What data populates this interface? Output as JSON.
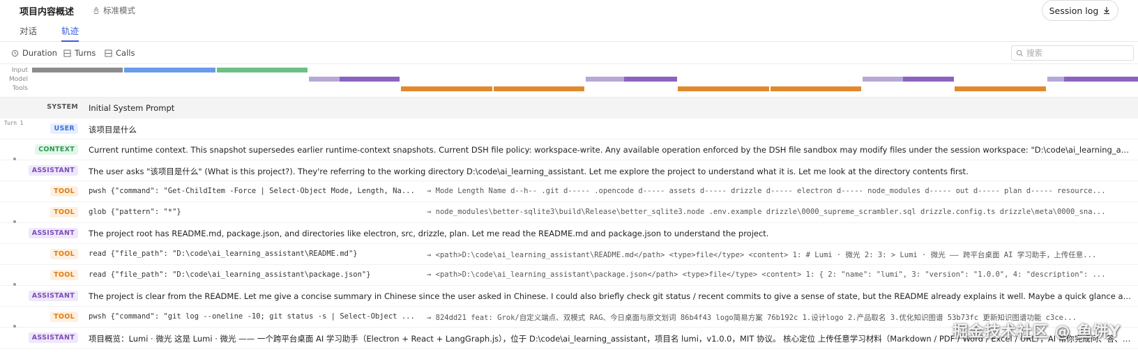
{
  "header": {
    "title": "项目内容概述",
    "mode_label": "标准模式",
    "tabs": [
      {
        "label": "对话"
      },
      {
        "label": "轨迹"
      }
    ],
    "session_log_label": "Session log"
  },
  "toolbar": {
    "duration_label": "Duration",
    "turns_label": "Turns",
    "calls_label": "Calls",
    "search_placeholder": "搜索"
  },
  "timeline": {
    "lanes": [
      "Input",
      "Model",
      "Tools"
    ],
    "colors": {
      "input_system": "#8c8c8c",
      "input_user": "#6b9ae8",
      "input_context": "#6dbf86",
      "model_light": "#b7a8d6",
      "model_dark": "#8a63c0",
      "tools": "#e08a2e"
    }
  },
  "rows": [
    {
      "type": "SYSTEM",
      "text": "Initial System Prompt"
    },
    {
      "type": "USER",
      "turn": "Turn 1",
      "text": "该项目是什么"
    },
    {
      "type": "CONTEXT",
      "text": "Current runtime context. This snapshot supersedes earlier runtime-context snapshots. Current DSH file policy: workspace-write. Any available operation enforced by the DSH file sandbox may modify files under the session workspace: \"D:\\code\\ai_learning_assistant\". Some platform t..."
    },
    {
      "type": "ASSISTANT",
      "text": "The user asks \"该项目是什么\" (What is this project?). They're referring to the working directory D:\\code\\ai_learning_assistant. Let me explore the project to understand what it is. Let me look at the directory contents first."
    },
    {
      "type": "TOOL",
      "cmd": "pwsh {\"command\": \"Get-ChildItem -Force | Select-Object Mode, Length, Na...",
      "out": "→ Mode Length Name d--h-- .git d----- .opencode d----- assets d----- drizzle d----- electron d----- node_modules d----- out d----- plan d----- resource..."
    },
    {
      "type": "TOOL",
      "cmd": "glob {\"pattern\": \"*\"}",
      "out": "→ node_modules\\better-sqlite3\\build\\Release\\better_sqlite3.node .env.example drizzle\\0000_supreme_scrambler.sql drizzle.config.ts drizzle\\meta\\0000_sna..."
    },
    {
      "type": "ASSISTANT",
      "text": "The project root has README.md, package.json, and directories like electron, src, drizzle, plan. Let me read the README.md and package.json to understand the project."
    },
    {
      "type": "TOOL",
      "cmd": "read {\"file_path\": \"D:\\code\\ai_learning_assistant\\README.md\"}",
      "out": "→ <path>D:\\code\\ai_learning_assistant\\README.md</path> <type>file</type> <content> 1: # Lumi · 微光 2: 3: > Lumi · 微光 —— 跨平台桌面 AI 学习助手，上传任意..."
    },
    {
      "type": "TOOL",
      "cmd": "read {\"file_path\": \"D:\\code\\ai_learning_assistant\\package.json\"}",
      "out": "→ <path>D:\\code\\ai_learning_assistant\\package.json</path> <type>file</type> <content> 1: { 2: \"name\": \"lumi\", 3: \"version\": \"1.0.0\", 4: \"description\": ..."
    },
    {
      "type": "ASSISTANT",
      "text": "The project is clear from the README. Let me give a concise summary in Chinese since the user asked in Chinese. I could also briefly check git status / recent commits to give a sense of state, but the README already explains it well. Maybe a quick glance at git log to know where de..."
    },
    {
      "type": "TOOL",
      "cmd": "pwsh {\"command\": \"git log --oneline -10; git status -s | Select-Object ...",
      "out": "→ 824dd21 feat: Grok/自定义端点、双模式 RAG、今日桌面与原文划词 86b4f43 logo简易方案 76b192c 1.设计logo 2.产品取名 3.优化知识图谱 53b73fc 更新知识图谱功能 c3ce..."
    },
    {
      "type": "ASSISTANT",
      "text": "项目概览：Lumi · 微光 这是 Lumi · 微光 —— 一个跨平台桌面 AI 学习助手（Electron + React + LangGraph.js），位于 D:\\code\\ai_learning_assistant，项目名 lumi，v1.0.0，MIT 协议。 核心定位 上传任意学习材料（Markdown / PDF / Word / Excel / URL），AI 帮你完成问、答、出题..."
    }
  ],
  "watermark": "掘金技术社区 @ 鱼饼Y"
}
